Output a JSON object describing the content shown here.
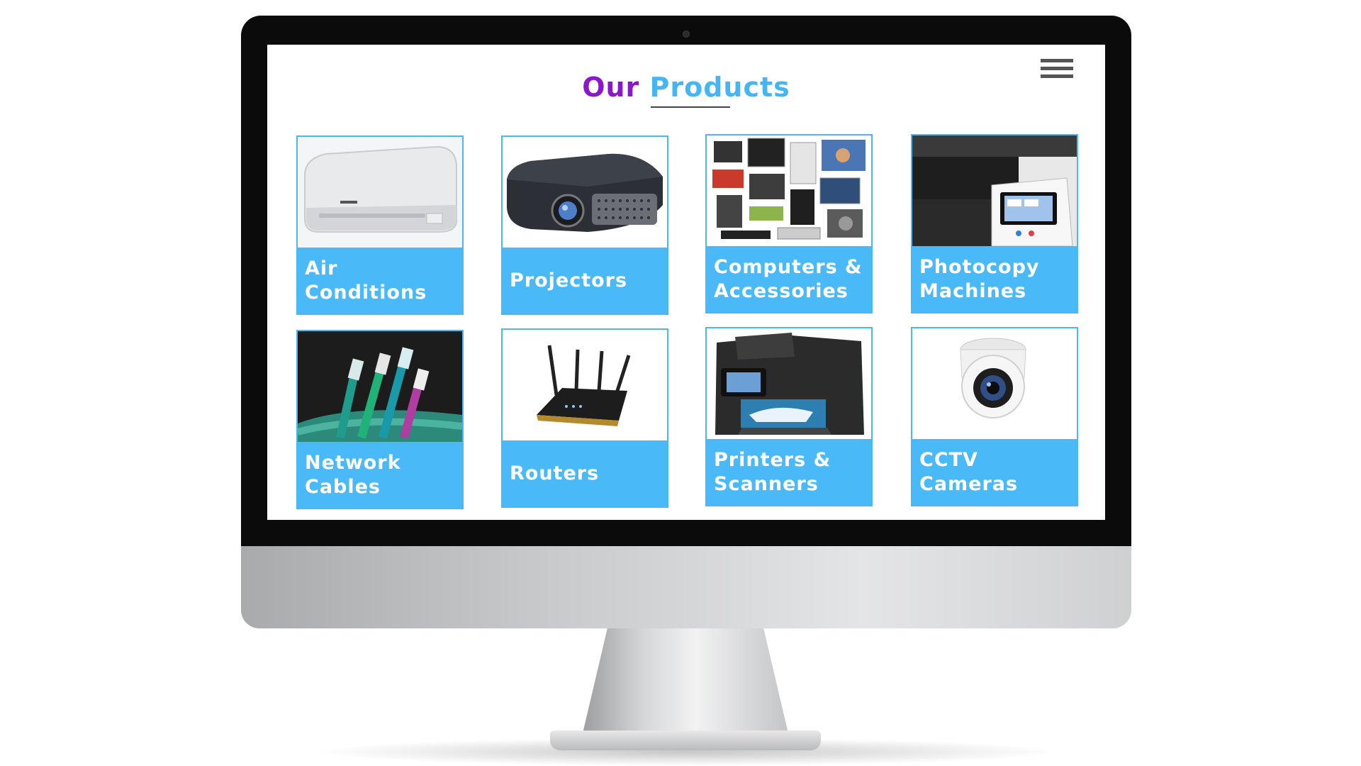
{
  "page": {
    "title_word1": "Our",
    "title_word2": "Products"
  },
  "menu": {
    "icon": "hamburger-menu-icon"
  },
  "colors": {
    "title_purple": "#8a17c9",
    "title_blue": "#45b6f3",
    "card_accent": "#4ab9f8",
    "bezel": "#0b0b0b"
  },
  "products": [
    {
      "label": "Air Conditions",
      "image": "air-conditioner-image"
    },
    {
      "label": "Projectors",
      "image": "projector-image"
    },
    {
      "label": "Computers & Accessories",
      "image": "computers-accessories-image"
    },
    {
      "label": "Photocopy Machines",
      "image": "photocopy-machine-image"
    },
    {
      "label": "Network Cables",
      "image": "network-cables-image"
    },
    {
      "label": "Routers",
      "image": "router-image"
    },
    {
      "label": "Printers & Scanners",
      "image": "printer-scanner-image"
    },
    {
      "label": "CCTV Cameras",
      "image": "cctv-camera-image"
    }
  ]
}
